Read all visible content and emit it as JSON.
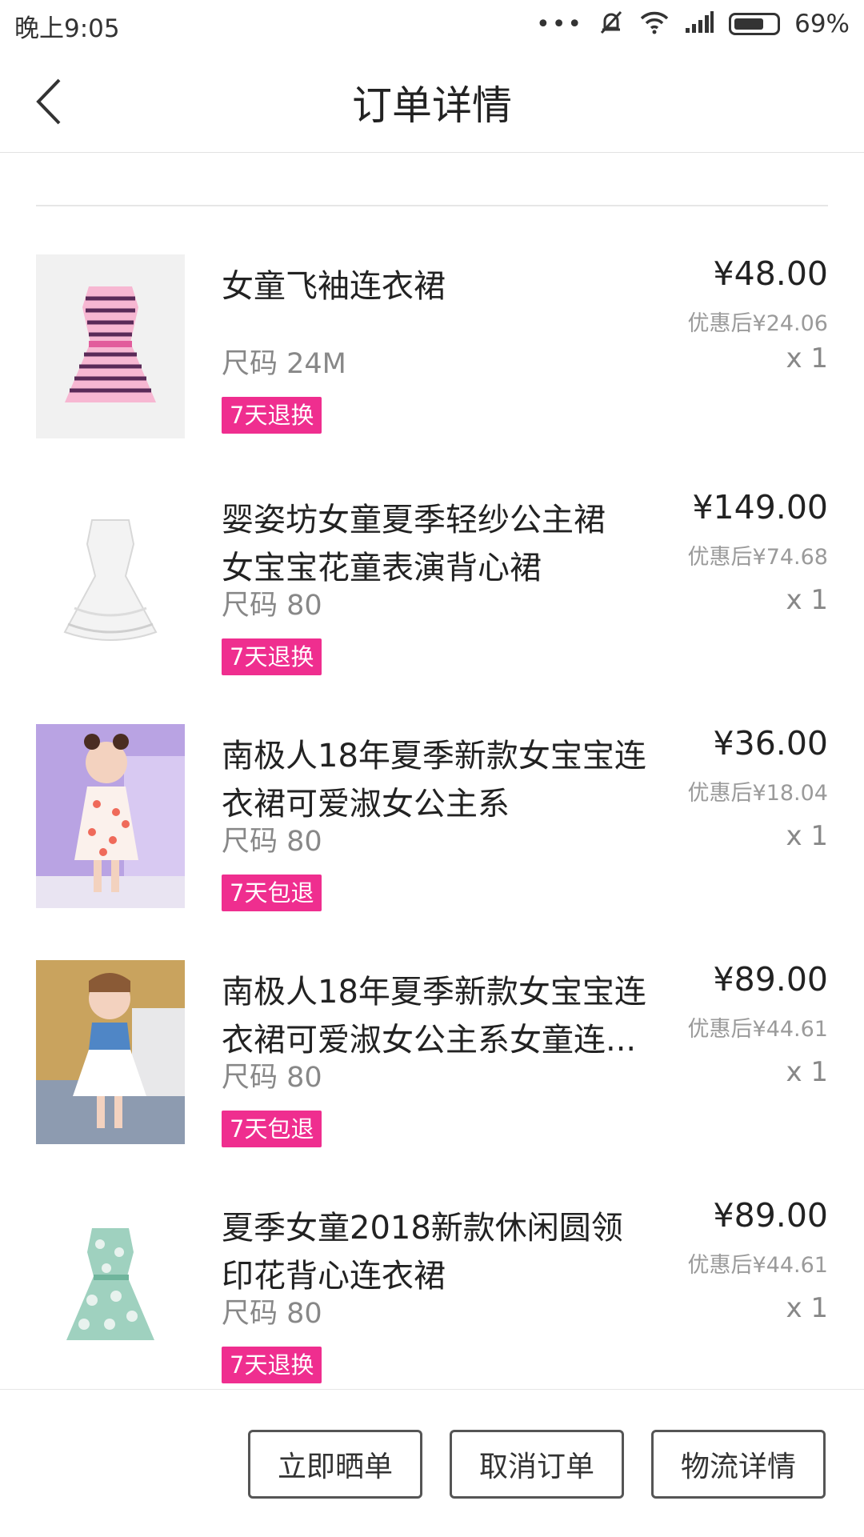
{
  "status_bar": {
    "time": "晚上9:05",
    "signal_dots": "•••",
    "battery_percent": "69%",
    "battery_level": 0.69
  },
  "nav": {
    "title": "订单详情"
  },
  "items": [
    {
      "name_line1": "女童飞袖连衣裙",
      "name_line2": "",
      "size": "尺码 24M",
      "badge": "7天退换",
      "price": "¥48.00",
      "discount_price": "优惠后¥24.06",
      "quantity": "x 1"
    },
    {
      "name_line1": "婴姿坊女童夏季轻纱公主裙",
      "name_line2": "女宝宝花童表演背心裙",
      "size": "尺码 80",
      "badge": "7天退换",
      "price": "¥149.00",
      "discount_price": "优惠后¥74.68",
      "quantity": "x 1"
    },
    {
      "name_line1": "南极人18年夏季新款女宝宝连",
      "name_line2": "衣裙可爱淑女公主系",
      "size": "尺码 80",
      "badge": "7天包退",
      "price": "¥36.00",
      "discount_price": "优惠后¥18.04",
      "quantity": "x 1"
    },
    {
      "name_line1": "南极人18年夏季新款女宝宝连",
      "name_line2": "衣裙可爱淑女公主系女童连...",
      "size": "尺码 80",
      "badge": "7天包退",
      "price": "¥89.00",
      "discount_price": "优惠后¥44.61",
      "quantity": "x 1"
    },
    {
      "name_line1": "夏季女童2018新款休闲圆领",
      "name_line2": "印花背心连衣裙",
      "size": "尺码 80",
      "badge": "7天退换",
      "price": "¥89.00",
      "discount_price": "优惠后¥44.61",
      "quantity": "x 1"
    }
  ],
  "actions": {
    "share": "立即晒单",
    "cancel": "取消订单",
    "logistics": "物流详情"
  },
  "colors": {
    "badge": "#ef2e8f",
    "text_primary": "#222222",
    "text_secondary": "#888888"
  }
}
